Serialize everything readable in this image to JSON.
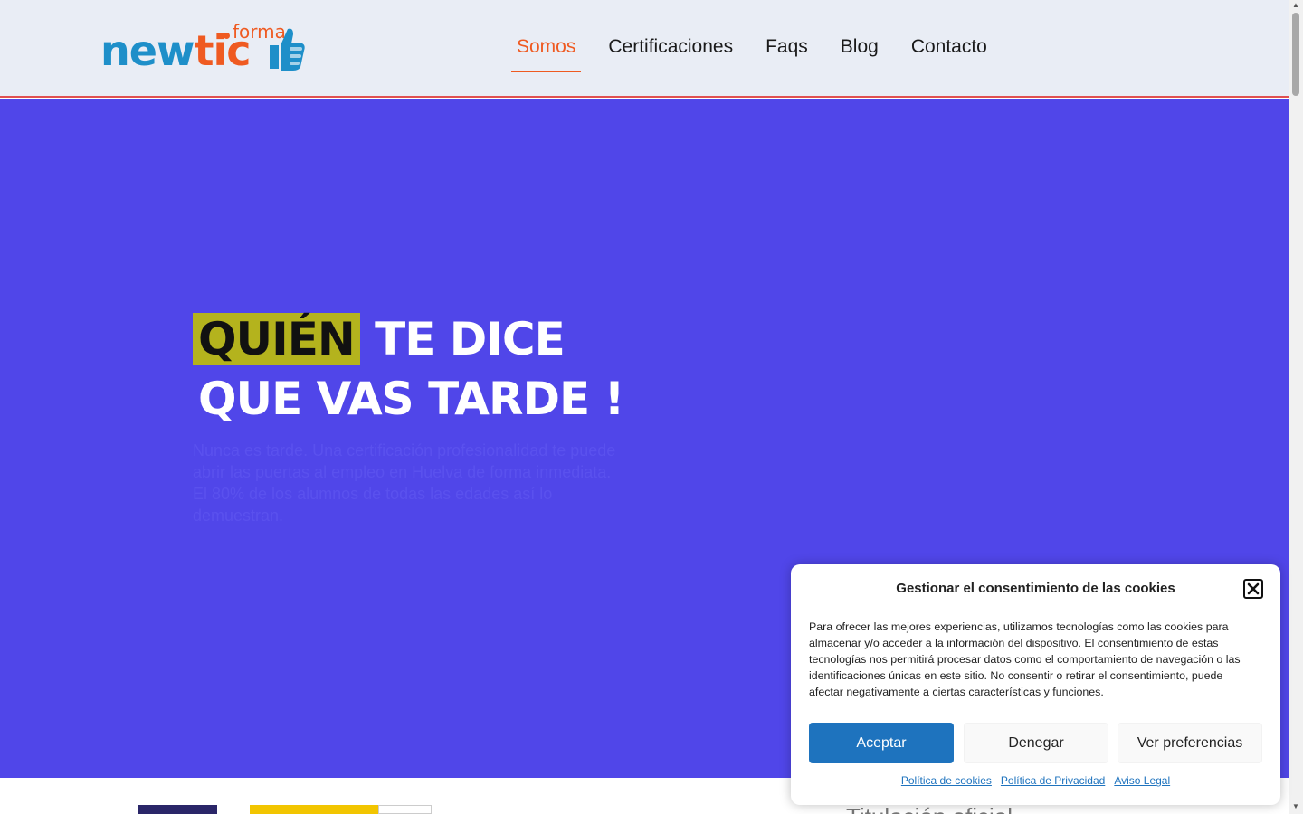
{
  "brand": {
    "logo_main": "new",
    "logo_accent": "tic",
    "logo_super": "forma",
    "colors": {
      "blue": "#1e8fc9",
      "orange": "#ef5a21"
    }
  },
  "nav": {
    "items": [
      {
        "label": "Somos",
        "active": true
      },
      {
        "label": "Certificaciones",
        "active": false
      },
      {
        "label": "Faqs",
        "active": false
      },
      {
        "label": "Blog",
        "active": false
      },
      {
        "label": "Contacto",
        "active": false
      }
    ]
  },
  "hero": {
    "title_highlight": "QUIÉN",
    "title_rest": " TE DICE",
    "title_line2": "QUE VAS TARDE !",
    "text": "Nunca es tarde. Una certificación profesionalidad te puede abrir las puertas al empleo en Huelva de forma inmediata. El 80% de los alumnos de todas las edades así lo demuestran.",
    "background": "#5046e9",
    "highlight_color": "#b4b31d"
  },
  "lower": {
    "heading": "Titulación oficial"
  },
  "cookie_banner": {
    "title": "Gestionar el consentimiento de las cookies",
    "close_icon": "close-icon",
    "text": "Para ofrecer las mejores experiencias, utilizamos tecnologías como las cookies para almacenar y/o acceder a la información del dispositivo. El consentimiento de estas tecnologías nos permitirá procesar datos como el comportamiento de navegación o las identificaciones únicas en este sitio. No consentir o retirar el consentimiento, puede afectar negativamente a ciertas características y funciones.",
    "accept_label": "Aceptar",
    "deny_label": "Denegar",
    "prefs_label": "Ver preferencias",
    "links": {
      "cookies": "Política de cookies",
      "privacy": "Política de Privacidad",
      "legal": "Aviso Legal"
    },
    "accent": "#1e73be"
  }
}
